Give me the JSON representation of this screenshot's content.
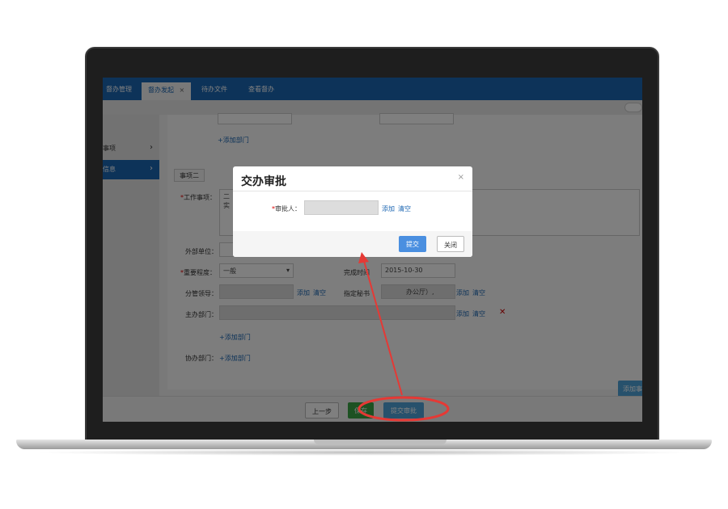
{
  "app": {
    "tabs": [
      {
        "label": "督办管理"
      },
      {
        "label": "督办发起",
        "close": "×"
      },
      {
        "label": "待办文件"
      },
      {
        "label": "查看督办"
      }
    ]
  },
  "sidebar": {
    "items": [
      {
        "label": "事项",
        "chev": "›"
      },
      {
        "label": "信息",
        "chev": "›"
      }
    ]
  },
  "form": {
    "add_dept": "+添加部门",
    "section_two": "事项二",
    "work_item_label": "工作事项：",
    "work_item_text": "二\n实",
    "external_unit_label": "外部单位：",
    "importance_label": "重要程度：",
    "importance_value": "一般",
    "completion_label": "完成时间",
    "completion_value": "2015-10-30",
    "leader_label": "分管领导：",
    "secretary_label": "指定秘书",
    "secretary_value": "办公厅）,",
    "host_dept_label": "主办部门：",
    "co_dept_label": "协办部门：",
    "add": "添加",
    "clear": "清空",
    "add_item_btn": "添加事"
  },
  "footer": {
    "prev": "上一步",
    "save": "保存",
    "submit": "提交审批"
  },
  "modal": {
    "title": "交办审批",
    "close": "×",
    "approver_label": "审批人：",
    "add": "添加",
    "clear": "清空",
    "confirm": "提交",
    "cancel": "关闭"
  },
  "colors": {
    "nav_blue": "#1b66b2",
    "save_green": "#3aa345",
    "confirm_blue": "#4a8fe0",
    "annotation_red": "#e53935"
  }
}
